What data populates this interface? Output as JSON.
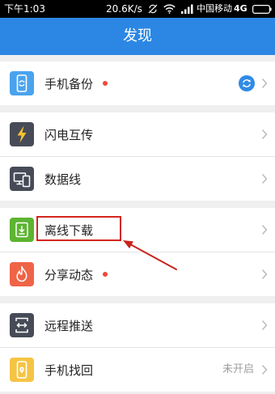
{
  "status_bar": {
    "time": "下午1:03",
    "net_speed": "20.6K/s",
    "carrier": "中国移动",
    "network_type": "4G",
    "icons": [
      "sync-off-icon",
      "wifi-icon",
      "signal-icon",
      "battery-icon"
    ]
  },
  "header": {
    "title": "发现",
    "background_color": "#2b87e3"
  },
  "groups": [
    {
      "items": [
        {
          "label": "手机备份",
          "icon": "phone-backup-icon",
          "icon_color": "#4aa3ee",
          "red_dot": true,
          "trailing_icon": "sync-icon"
        }
      ]
    },
    {
      "items": [
        {
          "label": "闪电互传",
          "icon": "flash-transfer-icon",
          "icon_color": "#464b57",
          "red_dot": false
        },
        {
          "label": "数据线",
          "icon": "data-cable-icon",
          "icon_color": "#464b57",
          "red_dot": false
        }
      ]
    },
    {
      "items": [
        {
          "label": "离线下载",
          "icon": "offline-download-icon",
          "icon_color": "#5cb431",
          "red_dot": false,
          "highlighted": true
        },
        {
          "label": "分享动态",
          "icon": "share-feed-icon",
          "icon_color": "#ef6447",
          "red_dot": true
        }
      ]
    },
    {
      "items": [
        {
          "label": "远程推送",
          "icon": "remote-push-icon",
          "icon_color": "#464b57",
          "red_dot": false
        },
        {
          "label": "手机找回",
          "icon": "find-phone-icon",
          "icon_color": "#f5c444",
          "red_dot": false,
          "status_text": "未开启"
        }
      ]
    }
  ],
  "colors": {
    "page_background": "#efefef",
    "red_dot": "#f2473a",
    "annotation": "#d3261d",
    "chevron": "#b8b8b8",
    "sync_badge": "#2f8be6",
    "lightning": "#f6c22f"
  }
}
